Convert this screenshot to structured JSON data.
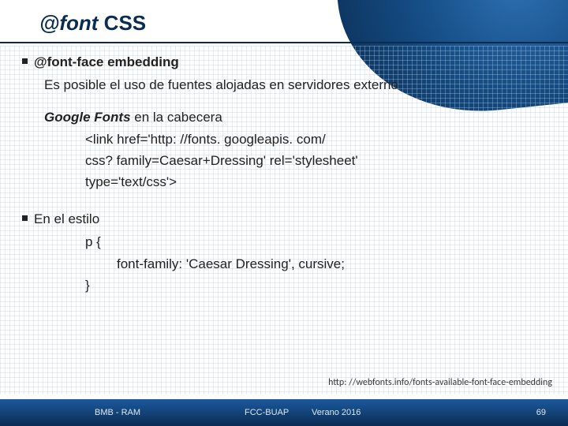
{
  "title_prefix": "@font",
  "title_suffix": " CSS",
  "section1_heading": "@font-face embedding",
  "section1_desc": "Es posible el uso de fuentes alojadas en servidores externo",
  "google_prefix_bold": "Google Fonts",
  "google_suffix": " en la cabecera",
  "link_line1": "<link href='http: //fonts. googleapis. com/",
  "link_line2": "css? family=Caesar+Dressing' rel='stylesheet'",
  "link_line3": "type='text/css'>",
  "section2_heading": "En el estilo",
  "css_open": "p {",
  "css_rule": "font-family: 'Caesar Dressing', cursive;",
  "css_close": "}",
  "weblink": "http: //webfonts.info/fonts-available-font-face-embedding",
  "footer": {
    "author": "BMB - RAM",
    "org": "FCC-BUAP",
    "term": "Verano 2016",
    "page": "69"
  }
}
